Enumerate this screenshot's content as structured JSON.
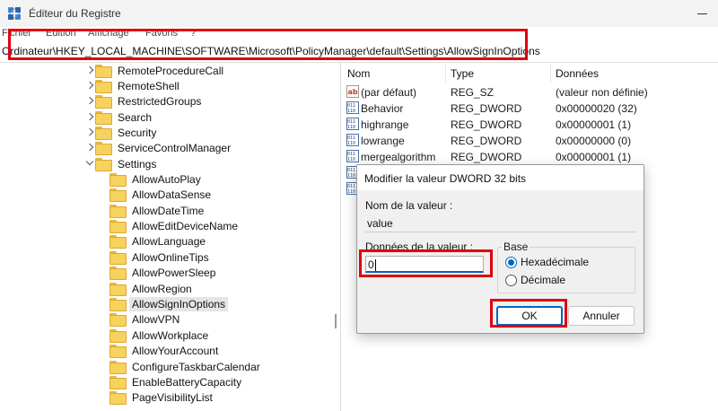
{
  "window": {
    "title": "Éditeur du Registre"
  },
  "menu": [
    "Fichier",
    "Edition",
    "Affichage",
    "Favoris",
    "?"
  ],
  "address": "Ordinateur\\HKEY_LOCAL_MACHINE\\SOFTWARE\\Microsoft\\PolicyManager\\default\\Settings\\AllowSignInOptions",
  "tree": {
    "items": [
      {
        "label": "RemoteProcedureCall",
        "expander": "right"
      },
      {
        "label": "RemoteShell",
        "expander": "right"
      },
      {
        "label": "RestrictedGroups",
        "expander": "right"
      },
      {
        "label": "Search",
        "expander": "right"
      },
      {
        "label": "Security",
        "expander": "right"
      },
      {
        "label": "ServiceControlManager",
        "expander": "right"
      },
      {
        "label": "Settings",
        "expander": "down"
      }
    ],
    "children": [
      "AllowAutoPlay",
      "AllowDataSense",
      "AllowDateTime",
      "AllowEditDeviceName",
      "AllowLanguage",
      "AllowOnlineTips",
      "AllowPowerSleep",
      "AllowRegion",
      "AllowSignInOptions",
      "AllowVPN",
      "AllowWorkplace",
      "AllowYourAccount",
      "ConfigureTaskbarCalendar",
      "EnableBatteryCapacity",
      "PageVisibilityList"
    ],
    "selected": "AllowSignInOptions"
  },
  "values": {
    "headers": {
      "name": "Nom",
      "type": "Type",
      "data": "Données"
    },
    "rows": [
      {
        "icon": "string-value-icon",
        "name": "(par défaut)",
        "type": "REG_SZ",
        "data": "(valeur non définie)"
      },
      {
        "icon": "dword-value-icon",
        "name": "Behavior",
        "type": "REG_DWORD",
        "data": "0x00000020 (32)"
      },
      {
        "icon": "dword-value-icon",
        "name": "highrange",
        "type": "REG_DWORD",
        "data": "0x00000001 (1)"
      },
      {
        "icon": "dword-value-icon",
        "name": "lowrange",
        "type": "REG_DWORD",
        "data": "0x00000000 (0)"
      },
      {
        "icon": "dword-value-icon",
        "name": "mergealgorithm",
        "type": "REG_DWORD",
        "data": "0x00000001 (1)"
      }
    ]
  },
  "dialog": {
    "title": "Modifier la valeur DWORD 32 bits",
    "name_label": "Nom de la valeur :",
    "name_value": "value",
    "data_label": "Données de la valeur :",
    "data_value": "0",
    "base_label": "Base",
    "hex_label": "Hexadécimale",
    "dec_label": "Décimale",
    "base_selected": "Hexadécimale",
    "ok_label": "OK",
    "cancel_label": "Annuler"
  },
  "colors": {
    "annotation": "#e0000e",
    "accent": "#0067c0",
    "folder": "#f7d25d"
  }
}
